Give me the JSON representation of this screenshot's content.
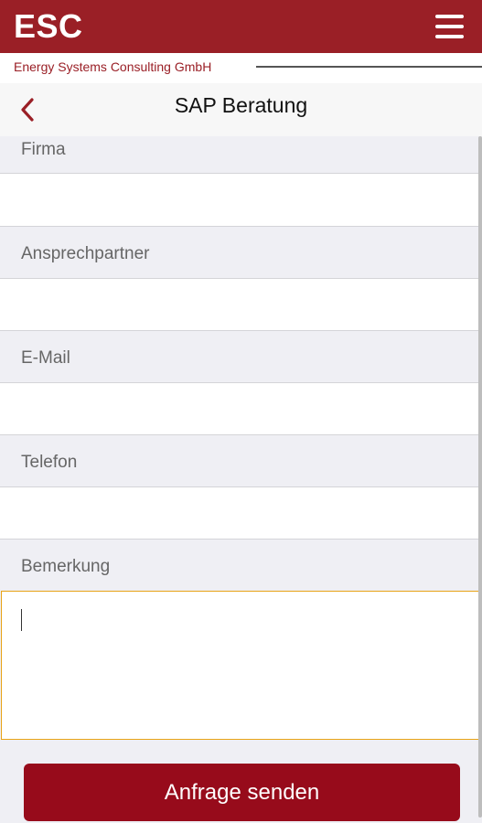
{
  "header": {
    "logo": "ESC",
    "menu_icon": "hamburger-menu-icon",
    "company": "Energy Systems Consulting GmbH",
    "brand_color": "#9a1f26"
  },
  "nav": {
    "back_icon": "chevron-left-icon",
    "title": "SAP Beratung"
  },
  "form": {
    "fields": [
      {
        "label": "Firma",
        "value": ""
      },
      {
        "label": "Ansprechpartner",
        "value": ""
      },
      {
        "label": "E-Mail",
        "value": ""
      },
      {
        "label": "Telefon",
        "value": ""
      },
      {
        "label": "Bemerkung",
        "value": ""
      }
    ],
    "submit_label": "Anfrage senden",
    "focus_color": "#e8a317"
  }
}
